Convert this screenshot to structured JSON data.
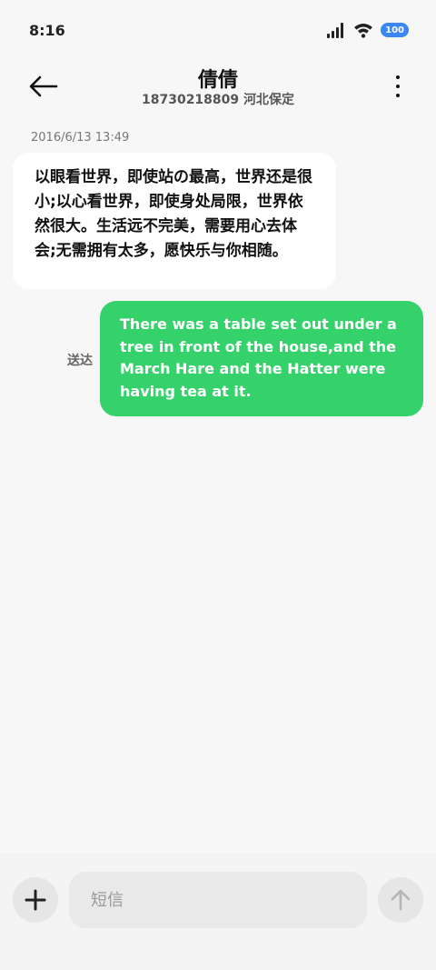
{
  "status_bar": {
    "time": "8:16",
    "battery": "100",
    "icons": [
      "signal-icon",
      "wifi-icon",
      "battery-icon"
    ],
    "battery_color": "#3a86f2"
  },
  "header": {
    "title": "倩倩",
    "subtitle": "18730218809 河北保定",
    "back_icon": "arrow-left-icon",
    "more_icon": "more-vertical-icon"
  },
  "messages": [
    {
      "direction": "incoming",
      "timestamp": "2016/6/13 13:49",
      "text": "以眼看世界，即使站の最高，世界还是很小;以心看世界，即使身处局限，世界依然很大。生活远不完美，需要用心去体会;无需拥有太多，愿快乐与你相随。"
    },
    {
      "direction": "outgoing",
      "status": "送达",
      "text": "There was a table set out under a tree in front of the house,and the March Hare and the Hatter were having tea at it."
    }
  ],
  "composer": {
    "placeholder": "短信",
    "value": "",
    "add_icon": "plus-icon",
    "send_icon": "arrow-up-icon"
  },
  "colors": {
    "outgoing_bubble": "#35d26b",
    "incoming_bubble": "#ffffff",
    "background": "#f7f7f7"
  }
}
